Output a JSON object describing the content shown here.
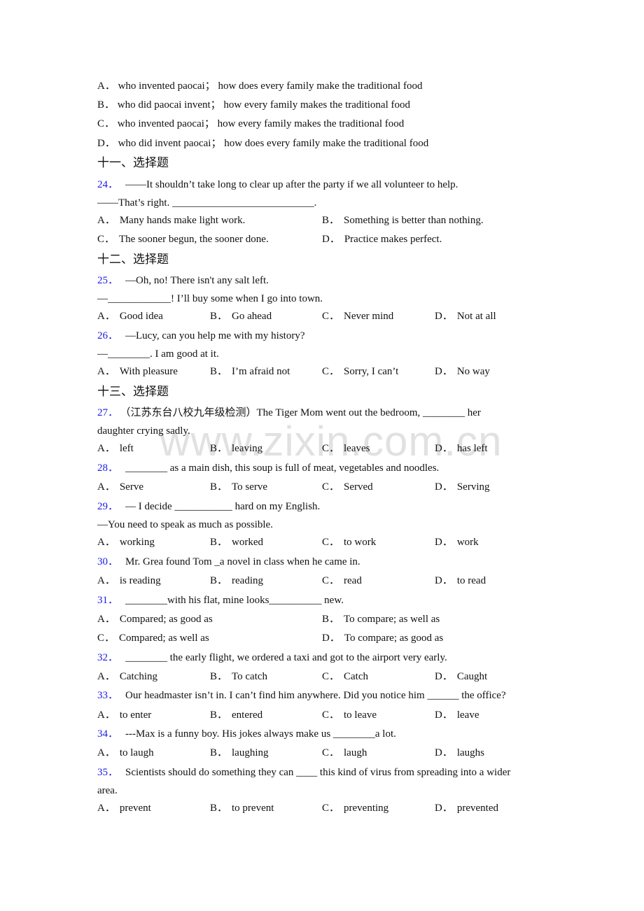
{
  "q23_options": [
    {
      "letter": "A．",
      "text": "who invented paocai； how does every family make the traditional food"
    },
    {
      "letter": "B．",
      "text": "who did paocai invent； how every family makes the traditional food"
    },
    {
      "letter": "C．",
      "text": "who invented paocai； how every family makes the traditional food"
    },
    {
      "letter": "D．",
      "text": "who did invent paocai； how does every family make the traditional food"
    }
  ],
  "sections": [
    {
      "title": "十一、选择题"
    },
    {
      "title": "十二、选择题"
    },
    {
      "title": "十三、选择题"
    }
  ],
  "questions": {
    "q24": {
      "num": "24．",
      "lines": [
        "——It shouldn’t take long to clear up after the party if we all volunteer to help.",
        "——That’s right. ___________________________."
      ],
      "options": [
        {
          "letter": "A．",
          "text": "Many hands make light work."
        },
        {
          "letter": "B．",
          "text": "Something is better than nothing."
        },
        {
          "letter": "C．",
          "text": "The sooner begun, the sooner done."
        },
        {
          "letter": "D．",
          "text": "Practice makes perfect."
        }
      ]
    },
    "q25": {
      "num": "25．",
      "lines": [
        "—Oh, no! There isn't any salt left.",
        "—____________! I’ll buy some when I go into town."
      ],
      "options": [
        {
          "letter": "A．",
          "text": "Good idea"
        },
        {
          "letter": "B．",
          "text": "Go ahead"
        },
        {
          "letter": "C．",
          "text": "Never mind"
        },
        {
          "letter": "D．",
          "text": "Not at all"
        }
      ]
    },
    "q26": {
      "num": "26．",
      "lines": [
        "—Lucy, can you help me with my history?",
        "—________. I am good at it."
      ],
      "options": [
        {
          "letter": "A．",
          "text": "With pleasure"
        },
        {
          "letter": "B．",
          "text": "I’m afraid not"
        },
        {
          "letter": "C．",
          "text": "Sorry, I can’t"
        },
        {
          "letter": "D．",
          "text": "No way"
        }
      ]
    },
    "q27": {
      "num": "27．",
      "lines": [
        "（江苏东台八校九年级检测）The Tiger Mom went out the bedroom, ________ her",
        "daughter crying sadly."
      ],
      "options": [
        {
          "letter": "A．",
          "text": "left"
        },
        {
          "letter": "B．",
          "text": "leaving"
        },
        {
          "letter": "C．",
          "text": "leaves"
        },
        {
          "letter": "D．",
          "text": "has left"
        }
      ]
    },
    "q28": {
      "num": "28．",
      "lines": [
        "________ as a main dish, this soup is full of meat, vegetables and noodles."
      ],
      "options": [
        {
          "letter": "A．",
          "text": "Serve"
        },
        {
          "letter": "B．",
          "text": "To serve"
        },
        {
          "letter": "C．",
          "text": "Served"
        },
        {
          "letter": "D．",
          "text": "Serving"
        }
      ]
    },
    "q29": {
      "num": "29．",
      "lines": [
        "— I decide ___________ hard on my English.",
        "—You need to speak as much as possible."
      ],
      "options": [
        {
          "letter": "A．",
          "text": "working"
        },
        {
          "letter": "B．",
          "text": "worked"
        },
        {
          "letter": "C．",
          "text": "to work"
        },
        {
          "letter": "D．",
          "text": "work"
        }
      ]
    },
    "q30": {
      "num": "30．",
      "lines": [
        "Mr. Grea found Tom _a novel in class when he came in."
      ],
      "options": [
        {
          "letter": "A．",
          "text": "is reading"
        },
        {
          "letter": "B．",
          "text": "reading"
        },
        {
          "letter": "C．",
          "text": "read"
        },
        {
          "letter": "D．",
          "text": "to read"
        }
      ]
    },
    "q31": {
      "num": "31．",
      "lines": [
        "________with his flat, mine looks__________ new."
      ],
      "options": [
        {
          "letter": "A．",
          "text": "Compared; as good as"
        },
        {
          "letter": "B．",
          "text": "To compare; as well as"
        },
        {
          "letter": "C．",
          "text": "Compared; as well as"
        },
        {
          "letter": "D．",
          "text": "To compare; as good as"
        }
      ]
    },
    "q32": {
      "num": "32．",
      "lines": [
        "________ the early flight, we ordered a taxi and got to the airport very early."
      ],
      "options": [
        {
          "letter": "A．",
          "text": "Catching"
        },
        {
          "letter": "B．",
          "text": "To catch"
        },
        {
          "letter": "C．",
          "text": "Catch"
        },
        {
          "letter": "D．",
          "text": "Caught"
        }
      ]
    },
    "q33": {
      "num": "33．",
      "lines": [
        "Our headmaster isn’t in. I can’t find him anywhere. Did you notice him ______ the office?"
      ],
      "options": [
        {
          "letter": "A．",
          "text": "to enter"
        },
        {
          "letter": "B．",
          "text": "entered"
        },
        {
          "letter": "C．",
          "text": "to leave"
        },
        {
          "letter": "D．",
          "text": "leave"
        }
      ]
    },
    "q34": {
      "num": "34．",
      "lines": [
        "---Max is a funny boy. His jokes always make us ________a lot."
      ],
      "options": [
        {
          "letter": "A．",
          "text": "to laugh"
        },
        {
          "letter": "B．",
          "text": "laughing"
        },
        {
          "letter": "C．",
          "text": "laugh"
        },
        {
          "letter": "D．",
          "text": "laughs"
        }
      ]
    },
    "q35": {
      "num": "35．",
      "lines": [
        "Scientists should do something they can ____ this kind of virus from spreading into a wider",
        "area."
      ],
      "options": [
        {
          "letter": "A．",
          "text": "prevent"
        },
        {
          "letter": "B．",
          "text": "to prevent"
        },
        {
          "letter": "C．",
          "text": "preventing"
        },
        {
          "letter": "D．",
          "text": "prevented"
        }
      ]
    }
  },
  "watermark": "www.zixin.com.cn",
  "colors": {
    "question_number": "#1a1ae6",
    "text": "#111111",
    "watermark": "#c8c8c8"
  }
}
